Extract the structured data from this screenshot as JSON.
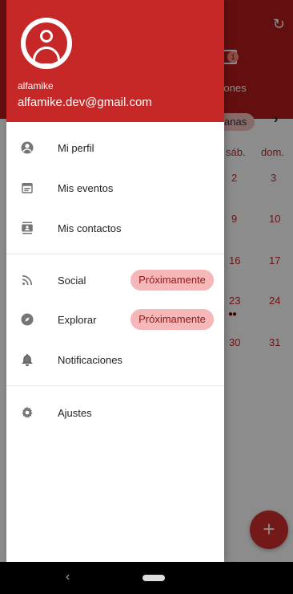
{
  "background": {
    "tab_badge": "1",
    "tab_label": "ciones",
    "weeks_chip": "anas",
    "weekday_headers": [
      "sáb.",
      "dom."
    ],
    "calendar_rows": [
      [
        "2",
        "3"
      ],
      [
        "9",
        "10"
      ],
      [
        "16",
        "17"
      ],
      [
        "23",
        "24"
      ],
      [
        "30",
        "31"
      ]
    ],
    "event_dots": "●●",
    "fab_label": "+"
  },
  "drawer": {
    "username": "alfamike",
    "email": "alfamike.dev@gmail.com",
    "items": [
      {
        "label": "Mi perfil",
        "icon": "account-circle-icon"
      },
      {
        "label": "Mis eventos",
        "icon": "calendar-icon"
      },
      {
        "label": "Mis contactos",
        "icon": "contacts-icon"
      },
      {
        "label": "Social",
        "icon": "rss-icon",
        "chip": "Próximamente"
      },
      {
        "label": "Explorar",
        "icon": "compass-icon",
        "chip": "Próximamente"
      },
      {
        "label": "Notificaciones",
        "icon": "bell-icon",
        "trailing_icon": "bell-outline-icon"
      },
      {
        "label": "Ajustes",
        "icon": "gear-icon"
      }
    ]
  },
  "colors": {
    "primary": "#c62828",
    "chip_bg": "#f5b7b7",
    "chip_text": "#8b1a1a"
  }
}
